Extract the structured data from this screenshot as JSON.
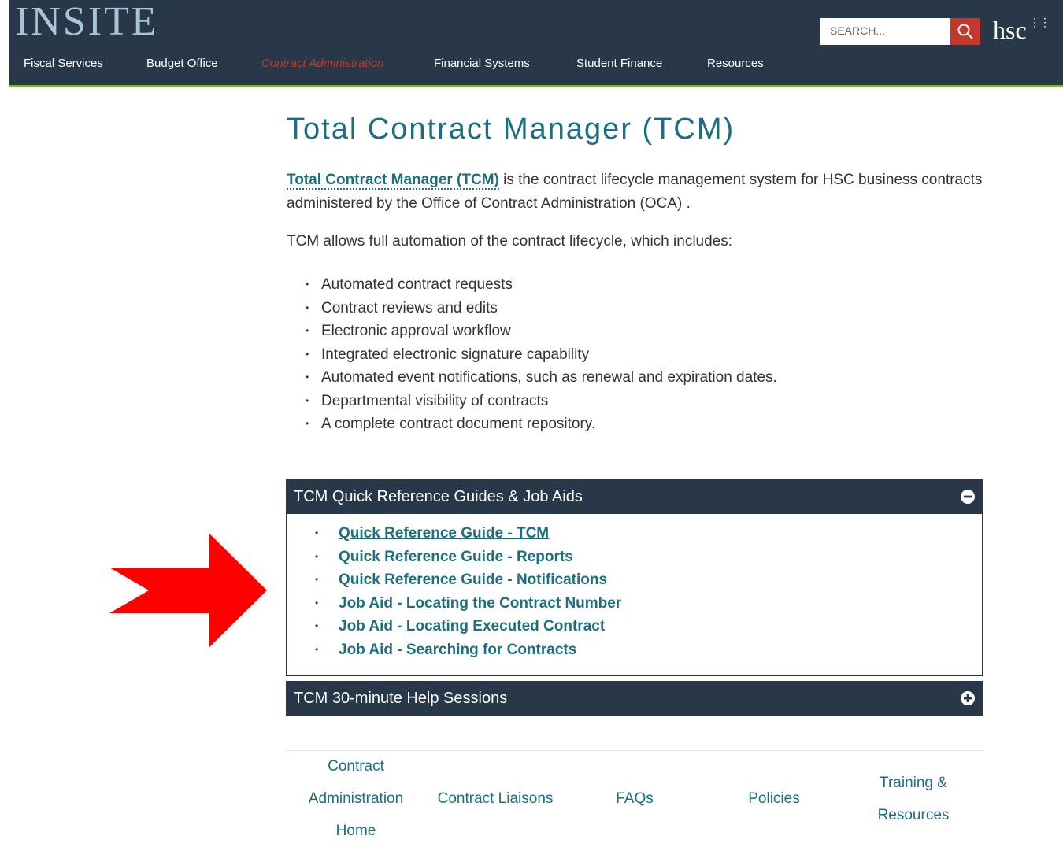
{
  "header": {
    "logo": "INSITE",
    "nav": [
      {
        "label": "Fiscal Services",
        "active": false
      },
      {
        "label": "Budget Office",
        "active": false
      },
      {
        "label": "Contract Administration",
        "active": true
      },
      {
        "label": "Financial Systems",
        "active": false
      },
      {
        "label": "Student Finance",
        "active": false
      },
      {
        "label": "Resources",
        "active": false
      }
    ],
    "search": {
      "placeholder": "SEARCH...",
      "value": ""
    },
    "brand": "hsc"
  },
  "main": {
    "title": "Total Contract Manager (TCM)",
    "intro_link": "Total Contract Manager (TCM)",
    "intro_rest": " is the contract lifecycle management system for HSC business contracts administered by the Office of Contract Administration (OCA) .",
    "allows": "TCM allows full automation of the contract lifecycle, which includes:",
    "features": [
      "Automated contract requests",
      "Contract reviews and edits",
      "Electronic approval workflow",
      "Integrated electronic signature capability",
      "Automated event notifications, such as renewal and expiration dates.",
      "Departmental visibility of contracts",
      "A complete contract document repository."
    ]
  },
  "accordion": [
    {
      "title": "TCM Quick Reference Guides & Job Aids",
      "expanded": true,
      "links": [
        "Quick Reference Guide - TCM",
        "Quick Reference Guide - Reports",
        "Quick Reference Guide - Notifications",
        "Job Aid - Locating the Contract Number",
        "Job Aid - Locating Executed Contract",
        "Job Aid - Searching for Contracts"
      ]
    },
    {
      "title": "TCM 30-minute Help Sessions",
      "expanded": false
    }
  ],
  "footer": {
    "links": [
      {
        "line1": "Contract",
        "line2": "Administration",
        "line3": "Home"
      },
      {
        "line1": "Contract Liaisons"
      },
      {
        "line1": "FAQs"
      },
      {
        "line1": "Policies"
      },
      {
        "line1": "Training &",
        "line2": "Resources"
      }
    ]
  },
  "colors": {
    "header_bg": "#283848",
    "accent_green": "#7cb342",
    "active_nav": "#c0392b",
    "link": "#1c6e80",
    "arrow": "#ff0000"
  }
}
